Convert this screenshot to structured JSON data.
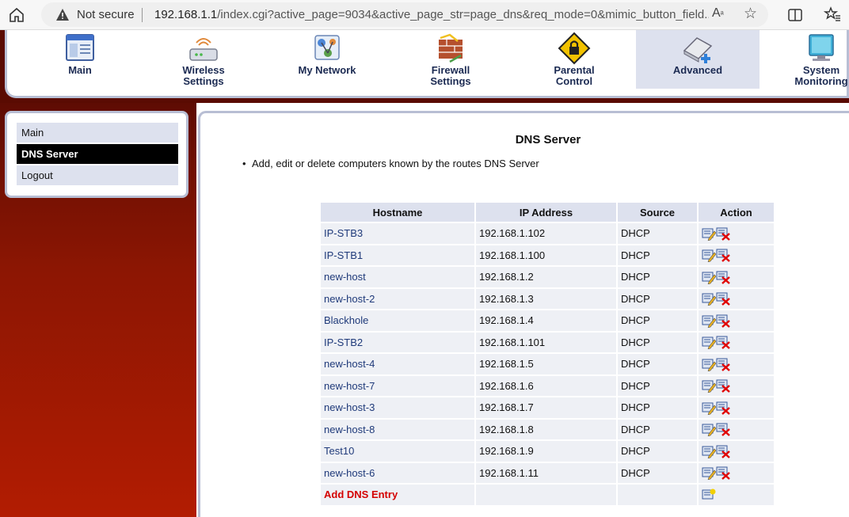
{
  "browser": {
    "security_label": "Not secure",
    "url_host": "192.168.1.1",
    "url_path": "/index.cgi?active_page=9034&active_page_str=page_dns&req_mode=0&mimic_button_field..."
  },
  "topnav": {
    "items": [
      {
        "label_line1": "Main",
        "label_line2": ""
      },
      {
        "label_line1": "Wireless",
        "label_line2": "Settings"
      },
      {
        "label_line1": "My Network",
        "label_line2": ""
      },
      {
        "label_line1": "Firewall",
        "label_line2": "Settings"
      },
      {
        "label_line1": "Parental",
        "label_line2": "Control"
      },
      {
        "label_line1": "Advanced",
        "label_line2": ""
      },
      {
        "label_line1": "System",
        "label_line2": "Monitoring"
      }
    ],
    "active": "Advanced"
  },
  "sidebar": {
    "items": [
      {
        "label": "Main"
      },
      {
        "label": "DNS Server"
      },
      {
        "label": "Logout"
      }
    ],
    "active": "DNS Server"
  },
  "main": {
    "title": "DNS Server",
    "description": "Add, edit or delete computers known by the routes DNS Server",
    "table": {
      "headers": [
        "Hostname",
        "IP Address",
        "Source",
        "Action"
      ],
      "rows": [
        {
          "hostname": "IP-STB3",
          "ip": "192.168.1.102",
          "source": "DHCP"
        },
        {
          "hostname": "IP-STB1",
          "ip": "192.168.1.100",
          "source": "DHCP"
        },
        {
          "hostname": "new-host",
          "ip": "192.168.1.2",
          "source": "DHCP"
        },
        {
          "hostname": "new-host-2",
          "ip": "192.168.1.3",
          "source": "DHCP"
        },
        {
          "hostname": "Blackhole",
          "ip": "192.168.1.4",
          "source": "DHCP"
        },
        {
          "hostname": "IP-STB2",
          "ip": "192.168.1.101",
          "source": "DHCP"
        },
        {
          "hostname": "new-host-4",
          "ip": "192.168.1.5",
          "source": "DHCP"
        },
        {
          "hostname": "new-host-7",
          "ip": "192.168.1.6",
          "source": "DHCP"
        },
        {
          "hostname": "new-host-3",
          "ip": "192.168.1.7",
          "source": "DHCP"
        },
        {
          "hostname": "new-host-8",
          "ip": "192.168.1.8",
          "source": "DHCP"
        },
        {
          "hostname": "Test10",
          "ip": "192.168.1.9",
          "source": "DHCP"
        },
        {
          "hostname": "new-host-6",
          "ip": "192.168.1.11",
          "source": "DHCP"
        }
      ],
      "add_label": "Add DNS Entry",
      "row_actions": [
        "edit-icon",
        "delete-icon"
      ],
      "add_action": "add-icon"
    }
  },
  "colors": {
    "nav_text": "#1b2a52",
    "accent_bg": "#dde1ee",
    "border": "#b8bed4",
    "sidebar_dark": "#5e0c03",
    "sidebar_light": "#b21c02",
    "add_label": "#d40000"
  }
}
